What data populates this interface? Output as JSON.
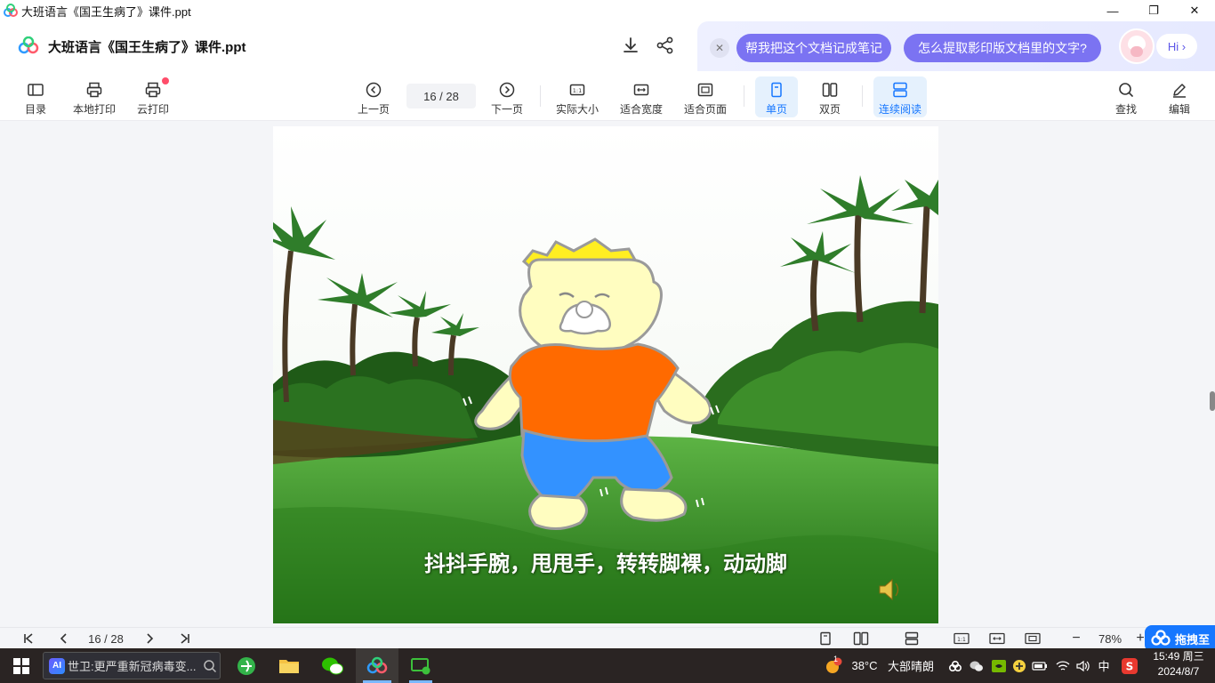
{
  "window": {
    "title": "大班语言《国王生病了》课件.ppt",
    "controls": [
      "—",
      "❐",
      "✕"
    ]
  },
  "header": {
    "doc_title": "大班语言《国王生病了》课件.ppt",
    "ai_prompts": [
      "帮我把这个文档记成笔记",
      "怎么提取影印版文档里的文字?"
    ],
    "ai_hi": "Hi"
  },
  "toolbar": {
    "catalog": "目录",
    "local_print": "本地打印",
    "cloud_print": "云打印",
    "prev_page": "上一页",
    "page_indicator": "16 / 28",
    "next_page": "下一页",
    "actual_size": "实际大小",
    "fit_width": "适合宽度",
    "fit_page": "适合页面",
    "single_page": "单页",
    "double_page": "双页",
    "continuous": "连续阅读",
    "find": "查找",
    "edit": "编辑"
  },
  "slide": {
    "caption": "抖抖手腕，甩甩手，转转脚裸，动动脚"
  },
  "statusbar": {
    "page_indicator": "16 / 28",
    "zoom": "78%"
  },
  "float_button": "拖拽至",
  "taskbar": {
    "search_text": "世卫:更严重新冠病毒变...",
    "weather_temp": "38°C",
    "weather_desc": "大部晴朗",
    "ime": "中",
    "time": "15:49 周三",
    "date": "2024/8/7",
    "weather_badge": "1"
  }
}
